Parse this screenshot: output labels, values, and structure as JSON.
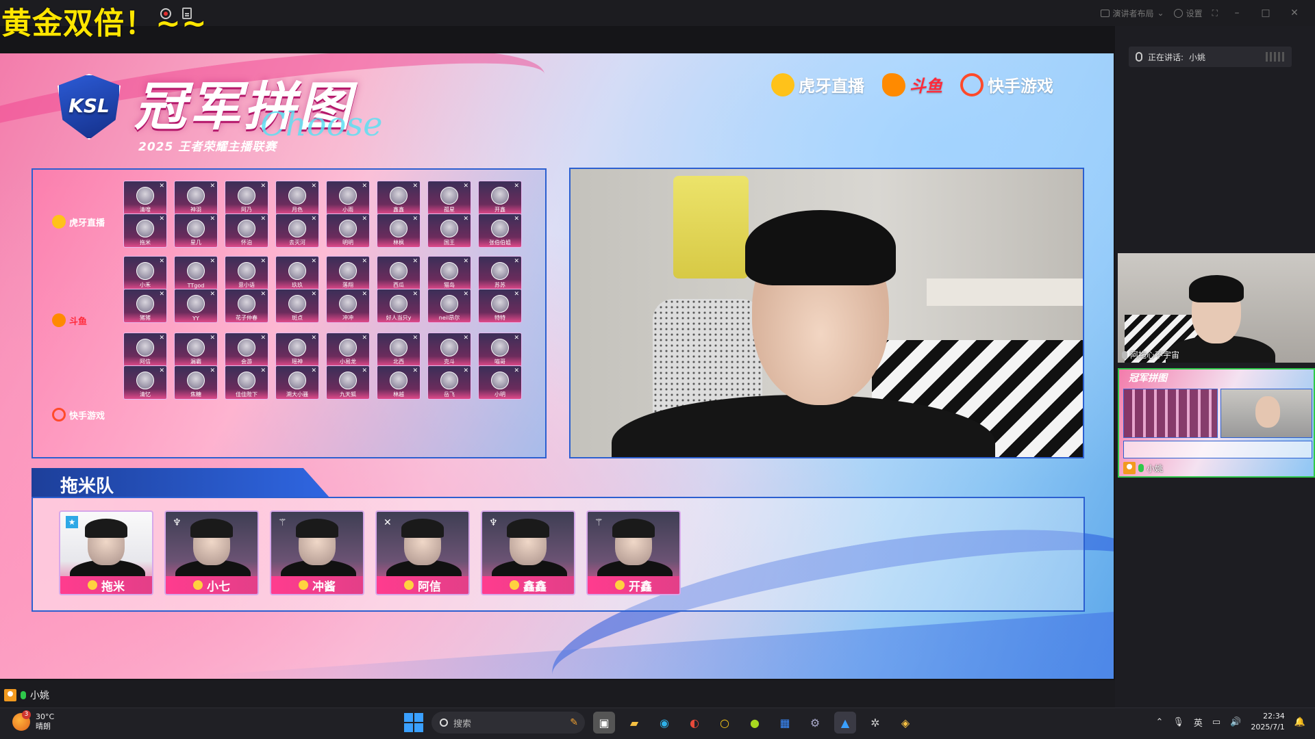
{
  "stream": {
    "title": "黄金双倍！~~"
  },
  "topbar": {
    "layout_label": "演讲者布局",
    "settings_label": "设置",
    "minimize": "–",
    "maximize": "□",
    "close": "✕",
    "more": "···"
  },
  "event": {
    "logo_text": "KSL",
    "title": "冠军拼图",
    "title_en": "Choose",
    "subtitle": "2025 王者荣耀主播联赛",
    "sponsors": [
      {
        "name": "虎牙直播",
        "icon": "huya-icon"
      },
      {
        "name": "斗鱼",
        "icon": "douyu-icon"
      },
      {
        "name": "快手游戏",
        "icon": "kuaishou-icon"
      }
    ]
  },
  "grid": {
    "platforms": [
      {
        "label": "虎牙直播",
        "icon": "huya-icon"
      },
      {
        "label": "斗鱼",
        "icon": "douyu-icon"
      },
      {
        "label": "快手游戏",
        "icon": "kuaishou-icon"
      }
    ],
    "rows": [
      [
        "清嗖",
        "神羽",
        "阿乃",
        "月色",
        "小雨",
        "鑫鑫",
        "孤星",
        "开鑫"
      ],
      [
        "拖米",
        "星几",
        "怀泊",
        "去灭河",
        "明明",
        "林枫",
        "国王",
        "张伯伯姐"
      ],
      [
        "小禾",
        "TTgod",
        "意小语",
        "玖玖",
        "落翔",
        "西瓜",
        "猫岛",
        "苏苏"
      ],
      [
        "猪猪",
        "YY",
        "花子仲春",
        "斑点",
        "冲冲",
        "好人当只y",
        "neil昂尔",
        "特特"
      ],
      [
        "阿信",
        "漏霸",
        "会游",
        "瑶神",
        "小易龙",
        "北西",
        "克斗",
        "喵哥"
      ],
      [
        "清忆",
        "焦糖",
        "佳佳陛下",
        "溯大小骚",
        "九天狐",
        "林越",
        "岳飞",
        "小明"
      ]
    ]
  },
  "team": {
    "name": "拖米队",
    "players": [
      {
        "name": "拖米",
        "badge": "★"
      },
      {
        "name": "小七",
        "badge": "♆"
      },
      {
        "name": "冲酱",
        "badge": "⚚"
      },
      {
        "name": "阿信",
        "badge": "✕"
      },
      {
        "name": "鑫鑫",
        "badge": "♆"
      },
      {
        "name": "开鑫",
        "badge": "⚚"
      }
    ]
  },
  "speaker_strip": {
    "name": "小姚"
  },
  "sidebar": {
    "speaking_label": "正在讲话:",
    "speaking_name": "小姚",
    "thumb1_label": "阿拖心不宇宙",
    "thumb2_title": "冠军拼图",
    "thumb2_label": "小姚"
  },
  "taskbar": {
    "temp": "30°C",
    "weather": "晴朗",
    "weather_badge": "3",
    "search_placeholder": "搜索",
    "ime": "英",
    "time": "22:34",
    "date": "2025/7/1",
    "apps": [
      "task-view-icon",
      "file-explorer-icon",
      "edge-icon",
      "browser-icon",
      "yellow-circle-icon",
      "green-app-icon",
      "blue-app-icon",
      "steam-icon",
      "meeting-app-icon",
      "settings-icon",
      "owl-app-icon"
    ]
  },
  "colors": {
    "title_yellow": "#ffe600",
    "accent_pink": "#ff3c8e",
    "frame_blue": "#2b5fd0",
    "speaker_green": "#2ec84a"
  }
}
